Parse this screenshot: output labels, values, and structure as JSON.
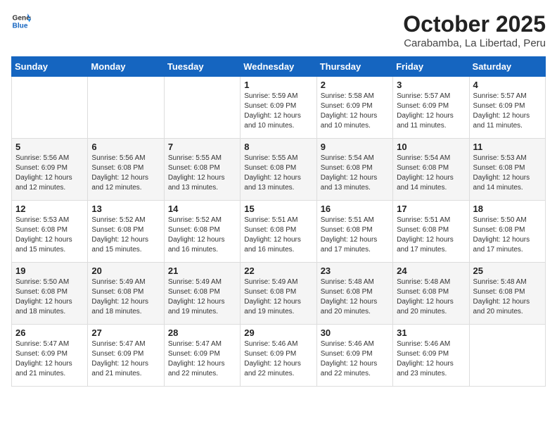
{
  "header": {
    "logo_general": "General",
    "logo_blue": "Blue",
    "month": "October 2025",
    "location": "Carabamba, La Libertad, Peru"
  },
  "weekdays": [
    "Sunday",
    "Monday",
    "Tuesday",
    "Wednesday",
    "Thursday",
    "Friday",
    "Saturday"
  ],
  "weeks": [
    [
      {
        "day": "",
        "sunrise": "",
        "sunset": "",
        "daylight": ""
      },
      {
        "day": "",
        "sunrise": "",
        "sunset": "",
        "daylight": ""
      },
      {
        "day": "",
        "sunrise": "",
        "sunset": "",
        "daylight": ""
      },
      {
        "day": "1",
        "sunrise": "Sunrise: 5:59 AM",
        "sunset": "Sunset: 6:09 PM",
        "daylight": "Daylight: 12 hours and 10 minutes."
      },
      {
        "day": "2",
        "sunrise": "Sunrise: 5:58 AM",
        "sunset": "Sunset: 6:09 PM",
        "daylight": "Daylight: 12 hours and 10 minutes."
      },
      {
        "day": "3",
        "sunrise": "Sunrise: 5:57 AM",
        "sunset": "Sunset: 6:09 PM",
        "daylight": "Daylight: 12 hours and 11 minutes."
      },
      {
        "day": "4",
        "sunrise": "Sunrise: 5:57 AM",
        "sunset": "Sunset: 6:09 PM",
        "daylight": "Daylight: 12 hours and 11 minutes."
      }
    ],
    [
      {
        "day": "5",
        "sunrise": "Sunrise: 5:56 AM",
        "sunset": "Sunset: 6:09 PM",
        "daylight": "Daylight: 12 hours and 12 minutes."
      },
      {
        "day": "6",
        "sunrise": "Sunrise: 5:56 AM",
        "sunset": "Sunset: 6:08 PM",
        "daylight": "Daylight: 12 hours and 12 minutes."
      },
      {
        "day": "7",
        "sunrise": "Sunrise: 5:55 AM",
        "sunset": "Sunset: 6:08 PM",
        "daylight": "Daylight: 12 hours and 13 minutes."
      },
      {
        "day": "8",
        "sunrise": "Sunrise: 5:55 AM",
        "sunset": "Sunset: 6:08 PM",
        "daylight": "Daylight: 12 hours and 13 minutes."
      },
      {
        "day": "9",
        "sunrise": "Sunrise: 5:54 AM",
        "sunset": "Sunset: 6:08 PM",
        "daylight": "Daylight: 12 hours and 13 minutes."
      },
      {
        "day": "10",
        "sunrise": "Sunrise: 5:54 AM",
        "sunset": "Sunset: 6:08 PM",
        "daylight": "Daylight: 12 hours and 14 minutes."
      },
      {
        "day": "11",
        "sunrise": "Sunrise: 5:53 AM",
        "sunset": "Sunset: 6:08 PM",
        "daylight": "Daylight: 12 hours and 14 minutes."
      }
    ],
    [
      {
        "day": "12",
        "sunrise": "Sunrise: 5:53 AM",
        "sunset": "Sunset: 6:08 PM",
        "daylight": "Daylight: 12 hours and 15 minutes."
      },
      {
        "day": "13",
        "sunrise": "Sunrise: 5:52 AM",
        "sunset": "Sunset: 6:08 PM",
        "daylight": "Daylight: 12 hours and 15 minutes."
      },
      {
        "day": "14",
        "sunrise": "Sunrise: 5:52 AM",
        "sunset": "Sunset: 6:08 PM",
        "daylight": "Daylight: 12 hours and 16 minutes."
      },
      {
        "day": "15",
        "sunrise": "Sunrise: 5:51 AM",
        "sunset": "Sunset: 6:08 PM",
        "daylight": "Daylight: 12 hours and 16 minutes."
      },
      {
        "day": "16",
        "sunrise": "Sunrise: 5:51 AM",
        "sunset": "Sunset: 6:08 PM",
        "daylight": "Daylight: 12 hours and 17 minutes."
      },
      {
        "day": "17",
        "sunrise": "Sunrise: 5:51 AM",
        "sunset": "Sunset: 6:08 PM",
        "daylight": "Daylight: 12 hours and 17 minutes."
      },
      {
        "day": "18",
        "sunrise": "Sunrise: 5:50 AM",
        "sunset": "Sunset: 6:08 PM",
        "daylight": "Daylight: 12 hours and 17 minutes."
      }
    ],
    [
      {
        "day": "19",
        "sunrise": "Sunrise: 5:50 AM",
        "sunset": "Sunset: 6:08 PM",
        "daylight": "Daylight: 12 hours and 18 minutes."
      },
      {
        "day": "20",
        "sunrise": "Sunrise: 5:49 AM",
        "sunset": "Sunset: 6:08 PM",
        "daylight": "Daylight: 12 hours and 18 minutes."
      },
      {
        "day": "21",
        "sunrise": "Sunrise: 5:49 AM",
        "sunset": "Sunset: 6:08 PM",
        "daylight": "Daylight: 12 hours and 19 minutes."
      },
      {
        "day": "22",
        "sunrise": "Sunrise: 5:49 AM",
        "sunset": "Sunset: 6:08 PM",
        "daylight": "Daylight: 12 hours and 19 minutes."
      },
      {
        "day": "23",
        "sunrise": "Sunrise: 5:48 AM",
        "sunset": "Sunset: 6:08 PM",
        "daylight": "Daylight: 12 hours and 20 minutes."
      },
      {
        "day": "24",
        "sunrise": "Sunrise: 5:48 AM",
        "sunset": "Sunset: 6:08 PM",
        "daylight": "Daylight: 12 hours and 20 minutes."
      },
      {
        "day": "25",
        "sunrise": "Sunrise: 5:48 AM",
        "sunset": "Sunset: 6:08 PM",
        "daylight": "Daylight: 12 hours and 20 minutes."
      }
    ],
    [
      {
        "day": "26",
        "sunrise": "Sunrise: 5:47 AM",
        "sunset": "Sunset: 6:09 PM",
        "daylight": "Daylight: 12 hours and 21 minutes."
      },
      {
        "day": "27",
        "sunrise": "Sunrise: 5:47 AM",
        "sunset": "Sunset: 6:09 PM",
        "daylight": "Daylight: 12 hours and 21 minutes."
      },
      {
        "day": "28",
        "sunrise": "Sunrise: 5:47 AM",
        "sunset": "Sunset: 6:09 PM",
        "daylight": "Daylight: 12 hours and 22 minutes."
      },
      {
        "day": "29",
        "sunrise": "Sunrise: 5:46 AM",
        "sunset": "Sunset: 6:09 PM",
        "daylight": "Daylight: 12 hours and 22 minutes."
      },
      {
        "day": "30",
        "sunrise": "Sunrise: 5:46 AM",
        "sunset": "Sunset: 6:09 PM",
        "daylight": "Daylight: 12 hours and 22 minutes."
      },
      {
        "day": "31",
        "sunrise": "Sunrise: 5:46 AM",
        "sunset": "Sunset: 6:09 PM",
        "daylight": "Daylight: 12 hours and 23 minutes."
      },
      {
        "day": "",
        "sunrise": "",
        "sunset": "",
        "daylight": ""
      }
    ]
  ]
}
